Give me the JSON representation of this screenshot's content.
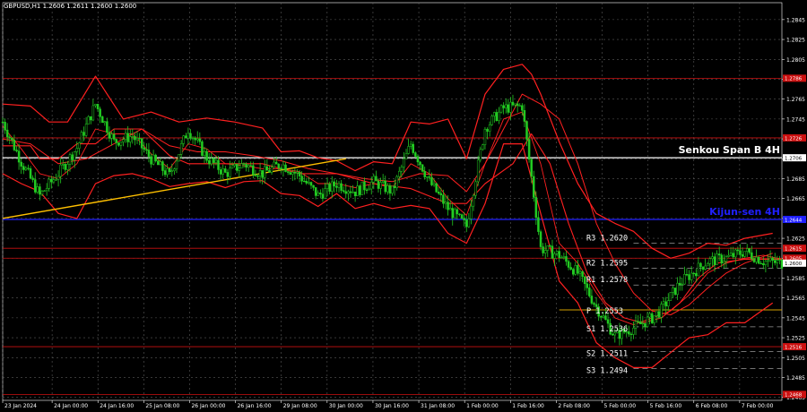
{
  "title": "GBPUSD,H1  1.2606 1.2611 1.2600 1.2600",
  "colors": {
    "background": "#000000",
    "grid": "#5a5a5a",
    "candle": "#22cc22",
    "ichimoku": "#ff2020",
    "trendline": "#ffc000",
    "senkou": "#ffffff",
    "kijun": "#2020ff",
    "level_red": "#cc1010",
    "pivot_dash": "#999999",
    "pivot_line": "#d4a000",
    "axis_text": "#ffffff",
    "price_tag": "#cc1010"
  },
  "chart_data": {
    "type": "line",
    "symbol": "GBPUSD",
    "timeframe": "H1",
    "ylim": [
      1.2462,
      1.2862
    ],
    "y_ticks": [
      "1.2845",
      "1.2825",
      "1.2805",
      "1.2785",
      "1.2765",
      "1.2745",
      "1.2725",
      "1.2705",
      "1.2685",
      "1.2665",
      "1.2645",
      "1.2625",
      "1.2605",
      "1.2585",
      "1.2565",
      "1.2545",
      "1.2525",
      "1.2505",
      "1.2485",
      "1.2465"
    ],
    "x_labels": [
      "23 Jan 2024",
      "24 Jan 00:00",
      "24 Jan 16:00",
      "25 Jan 08:00",
      "26 Jan 00:00",
      "26 Jan 16:00",
      "29 Jan 08:00",
      "30 Jan 00:00",
      "30 Jan 16:00",
      "31 Jan 08:00",
      "1 Feb 00:00",
      "1 Feb 16:00",
      "2 Feb 08:00",
      "5 Feb 00:00",
      "5 Feb 16:00",
      "6 Feb 08:00",
      "7 Feb 00:00"
    ],
    "x_range": [
      0,
      168
    ],
    "price_series": {
      "name": "GBPUSD H1",
      "x": [
        0,
        4,
        8,
        12,
        16,
        20,
        24,
        28,
        32,
        36,
        40,
        44,
        48,
        52,
        56,
        60,
        64,
        68,
        72,
        76,
        80,
        84,
        88,
        92,
        96,
        100,
        104,
        108,
        112,
        116,
        120,
        124,
        128,
        132,
        136,
        140,
        142,
        146,
        150,
        152,
        156,
        160,
        164,
        168
      ],
      "y": [
        1.2742,
        1.2702,
        1.2668,
        1.269,
        1.2716,
        1.276,
        1.2722,
        1.2728,
        1.2705,
        1.2688,
        1.2735,
        1.2706,
        1.269,
        1.27,
        1.269,
        1.27,
        1.2688,
        1.2668,
        1.268,
        1.2672,
        1.2682,
        1.2672,
        1.272,
        1.2682,
        1.2655,
        1.2637,
        1.2736,
        1.2756,
        1.2758,
        1.2615,
        1.2608,
        1.259,
        1.2556,
        1.2527,
        1.2535,
        1.2545,
        1.2553,
        1.258,
        1.2595,
        1.2602,
        1.2605,
        1.2612,
        1.2602,
        1.26
      ]
    },
    "kijun_series": {
      "x": [
        0,
        6,
        8,
        12,
        16,
        20,
        24,
        30,
        36,
        40,
        46,
        52,
        56,
        64,
        72,
        80,
        88,
        96,
        100,
        104,
        110,
        114,
        118,
        122,
        126,
        130,
        134,
        138,
        142,
        146,
        150,
        154,
        160,
        168
      ],
      "y": [
        1.2718,
        1.2718,
        1.2705,
        1.2705,
        1.272,
        1.272,
        1.2735,
        1.2735,
        1.2708,
        1.27,
        1.27,
        1.27,
        1.27,
        1.269,
        1.269,
        1.268,
        1.2675,
        1.266,
        1.266,
        1.268,
        1.27,
        1.273,
        1.27,
        1.264,
        1.259,
        1.256,
        1.2545,
        1.254,
        1.2545,
        1.256,
        1.2585,
        1.26,
        1.2604,
        1.2604
      ]
    },
    "tenkan_series": {
      "x": [
        0,
        4,
        8,
        12,
        16,
        20,
        24,
        28,
        32,
        36,
        40,
        44,
        48,
        52,
        56,
        60,
        64,
        68,
        72,
        76,
        80,
        84,
        88,
        92,
        96,
        100,
        104,
        108,
        112,
        116,
        120,
        124,
        128,
        132,
        136,
        140,
        144,
        148,
        152,
        156,
        160,
        164,
        168
      ],
      "y": [
        1.2738,
        1.2715,
        1.269,
        1.2685,
        1.27,
        1.2735,
        1.273,
        1.273,
        1.271,
        1.2695,
        1.272,
        1.2715,
        1.27,
        1.2698,
        1.2695,
        1.2695,
        1.2692,
        1.268,
        1.268,
        1.2676,
        1.268,
        1.2676,
        1.27,
        1.269,
        1.2665,
        1.2648,
        1.27,
        1.2745,
        1.2752,
        1.27,
        1.262,
        1.26,
        1.257,
        1.2545,
        1.2538,
        1.2545,
        1.2552,
        1.2568,
        1.259,
        1.26,
        1.2605,
        1.2608,
        1.2604
      ]
    },
    "bollinger_upper": {
      "x": [
        0,
        6,
        10,
        14,
        20,
        26,
        32,
        38,
        44,
        50,
        56,
        60,
        64,
        68,
        72,
        76,
        80,
        84,
        88,
        92,
        96,
        100,
        104,
        108,
        112,
        114,
        116,
        120,
        124,
        128,
        132,
        136,
        140,
        144,
        148,
        152,
        156,
        160,
        166
      ],
      "y": [
        1.276,
        1.2758,
        1.2742,
        1.2742,
        1.2788,
        1.2745,
        1.2752,
        1.2742,
        1.2746,
        1.2742,
        1.2736,
        1.2712,
        1.2713,
        1.2706,
        1.2703,
        1.2693,
        1.2702,
        1.27,
        1.2742,
        1.274,
        1.2745,
        1.2705,
        1.277,
        1.2795,
        1.28,
        1.279,
        1.277,
        1.2722,
        1.268,
        1.265,
        1.264,
        1.2632,
        1.2615,
        1.2605,
        1.261,
        1.262,
        1.2618,
        1.2625,
        1.263
      ]
    },
    "bollinger_lower": {
      "x": [
        0,
        4,
        8,
        12,
        16,
        20,
        24,
        28,
        32,
        36,
        40,
        44,
        48,
        52,
        56,
        60,
        64,
        68,
        72,
        76,
        80,
        84,
        88,
        92,
        96,
        100,
        104,
        108,
        112,
        116,
        120,
        124,
        128,
        132,
        136,
        140,
        144,
        148,
        152,
        156,
        160,
        166
      ],
      "y": [
        1.269,
        1.268,
        1.2672,
        1.265,
        1.2645,
        1.268,
        1.2688,
        1.269,
        1.2685,
        1.2677,
        1.268,
        1.2682,
        1.2676,
        1.2682,
        1.2683,
        1.267,
        1.2668,
        1.2657,
        1.267,
        1.2655,
        1.266,
        1.2655,
        1.2658,
        1.2655,
        1.263,
        1.262,
        1.266,
        1.272,
        1.272,
        1.265,
        1.2582,
        1.256,
        1.252,
        1.2505,
        1.2495,
        1.2495,
        1.251,
        1.2525,
        1.2528,
        1.254,
        1.254,
        1.256
      ]
    },
    "bollinger_mid": {
      "x": [
        0,
        6,
        12,
        18,
        24,
        30,
        36,
        42,
        48,
        54,
        60,
        66,
        72,
        78,
        84,
        90,
        96,
        100,
        104,
        108,
        112,
        116,
        120,
        124,
        128,
        132,
        136,
        140,
        144,
        148,
        152,
        156,
        160,
        166
      ],
      "y": [
        1.2725,
        1.272,
        1.27,
        1.2705,
        1.272,
        1.2735,
        1.2718,
        1.2712,
        1.2712,
        1.2708,
        1.2703,
        1.2695,
        1.269,
        1.2685,
        1.2682,
        1.269,
        1.2688,
        1.2672,
        1.27,
        1.2735,
        1.277,
        1.276,
        1.2745,
        1.27,
        1.264,
        1.26,
        1.257,
        1.2552,
        1.2548,
        1.2558,
        1.2575,
        1.259,
        1.26,
        1.261
      ]
    },
    "trendline": {
      "x": [
        0,
        74
      ],
      "y": [
        1.2645,
        1.2705
      ]
    },
    "horizontal_levels": [
      {
        "label": "Senkou Span B 4H",
        "value": 1.2706,
        "color_key": "senkou",
        "tag": "1.2706"
      },
      {
        "label": "Kijun-sen 4H",
        "value": 1.2644,
        "color_key": "kijun",
        "tag": "1.2644"
      },
      {
        "label": "",
        "value": 1.2786,
        "color_key": "level_red",
        "tag": "1.2786"
      },
      {
        "label": "",
        "value": 1.2726,
        "color_key": "level_red",
        "tag": "1.2726"
      },
      {
        "label": "",
        "value": 1.2615,
        "color_key": "level_red",
        "tag": "1.2615"
      },
      {
        "label": "",
        "value": 1.2605,
        "color_key": "level_red",
        "tag": "1.2605"
      },
      {
        "label": "",
        "value": 1.2516,
        "color_key": "level_red",
        "tag": "1.2516"
      },
      {
        "label": "",
        "value": 1.2468,
        "color_key": "level_red",
        "tag": "1.2468"
      }
    ],
    "current_price": {
      "value": 1.26,
      "tag": "1.2600"
    },
    "pivots": [
      {
        "label": "R3",
        "value": 1.262,
        "text": "1.2620"
      },
      {
        "label": "R2",
        "value": 1.2595,
        "text": "1.2595"
      },
      {
        "label": "R1",
        "value": 1.2578,
        "text": "1.2578"
      },
      {
        "label": "P",
        "value": 1.2553,
        "text": "1.2553"
      },
      {
        "label": "S1",
        "value": 1.2536,
        "text": "1.2536"
      },
      {
        "label": "S2",
        "value": 1.2511,
        "text": "1.2511"
      },
      {
        "label": "S3",
        "value": 1.2494,
        "text": "1.2494"
      }
    ],
    "pivot_start_x": 136,
    "grid": true
  }
}
